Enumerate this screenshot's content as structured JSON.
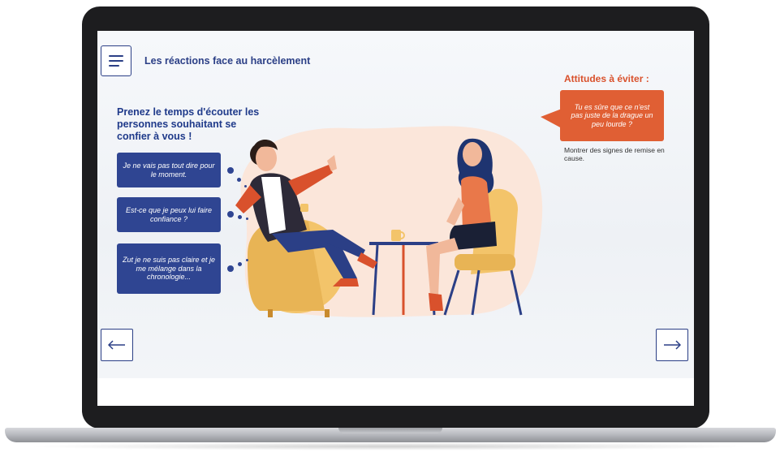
{
  "header": {
    "title": "Les réactions face au harcèlement",
    "menu_icon": "hamburger-menu-icon"
  },
  "left_panel": {
    "heading": "Prenez le temps d'écouter les personnes souhaitant se confier à vous !",
    "bubbles": [
      "Je ne vais pas tout dire pour le moment.",
      "Est-ce que je peux lui faire confiance ?",
      "Zut je ne suis pas claire et je me mélange dans la chronologie..."
    ]
  },
  "right_panel": {
    "title": "Attitudes à éviter :",
    "quote": "Tu es sûre que ce n'est pas juste de la drague un peu lourde ?",
    "caption": "Montrer des signes de remise en cause."
  },
  "navigation": {
    "prev_icon": "arrow-left-icon",
    "next_icon": "arrow-right-icon"
  },
  "colors": {
    "brand_blue": "#2b3f86",
    "bubble_blue": "#2f4592",
    "accent_orange": "#e05f34"
  }
}
